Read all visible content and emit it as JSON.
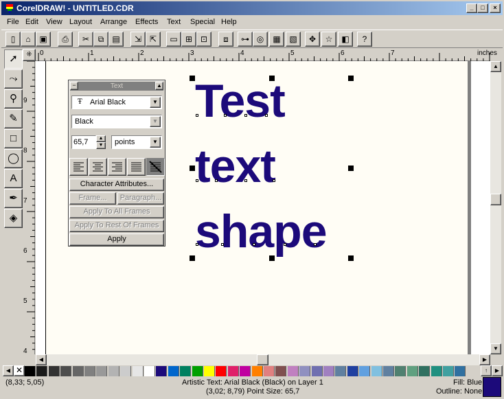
{
  "window": {
    "title": "CorelDRAW! - UNTITLED.CDR",
    "minimize": "_",
    "maximize": "□",
    "close": "×"
  },
  "menu": [
    "File",
    "Edit",
    "View",
    "Layout",
    "Arrange",
    "Effects",
    "Text",
    "Special",
    "Help"
  ],
  "toolbar": {
    "icons": [
      "new-file-icon",
      "open-file-icon",
      "save-icon",
      "print-icon",
      "cut-icon",
      "copy-icon",
      "paste-icon",
      "import-icon",
      "export-icon",
      "full-screen-preview-icon",
      "wireframe-icon",
      "zoom-selected-icon",
      "group-icon",
      "ungroup-icon",
      "to-front-icon",
      "to-back-icon",
      "align-icon",
      "transform-icon",
      "symbols-icon",
      "envelope-icon",
      "whats-this-help-icon"
    ]
  },
  "toolbox": {
    "tools": [
      "pick-tool-icon",
      "shape-tool-icon",
      "zoom-tool-icon",
      "pencil-tool-icon",
      "rectangle-tool-icon",
      "ellipse-tool-icon",
      "text-tool-icon",
      "outline-tool-icon",
      "fill-tool-icon"
    ]
  },
  "rulers": {
    "unit": "inches",
    "h_labels": [
      "0",
      "1",
      "2",
      "3",
      "4",
      "5",
      "6",
      "7"
    ],
    "v_labels": [
      "9",
      "8",
      "7",
      "6",
      "5",
      "4"
    ]
  },
  "rollup": {
    "title": "Text",
    "font": "Arial Black",
    "style": "Black",
    "size": "65,7",
    "unit": "points",
    "align_icons": [
      "align-left-icon",
      "align-center-icon",
      "align-right-icon",
      "justify-icon",
      "no-alignment-icon"
    ],
    "character_attributes": "Character Attributes...",
    "frame": "Frame...",
    "paragraph": "Paragraph...",
    "apply_all": "Apply To All Frames",
    "apply_rest": "Apply To Rest Of Frames",
    "apply": "Apply"
  },
  "artistic_text": {
    "lines": [
      "Test",
      "text",
      "shape"
    ]
  },
  "palette": {
    "colors": [
      "#000000",
      "#1a1a1a",
      "#333333",
      "#4d4d4d",
      "#666666",
      "#808080",
      "#999999",
      "#b3b3b3",
      "#cccccc",
      "#e6e6e6",
      "#ffffff",
      "#1c0a7a",
      "#0066cc",
      "#008060",
      "#00a000",
      "#ffff00",
      "#ff0000",
      "#e0206a",
      "#c000a0",
      "#ff8000",
      "#e08080",
      "#805050",
      "#c080c0",
      "#9090c0",
      "#7070b0",
      "#a080c0",
      "#6080a0",
      "#2040a0",
      "#60a0e0",
      "#80c0e0",
      "#6080a0",
      "#508070",
      "#60a080",
      "#307060",
      "#209080",
      "#40a0a0",
      "#3070a0"
    ]
  },
  "status": {
    "coords": "(8,33; 5,05)",
    "object_info": "Artistic Text: Arial Black (Black) on Layer 1",
    "object_detail": "(3,02; 8,79)  Point Size: 65,7",
    "fill": "Fill: Blue",
    "outline": "Outline: None"
  }
}
